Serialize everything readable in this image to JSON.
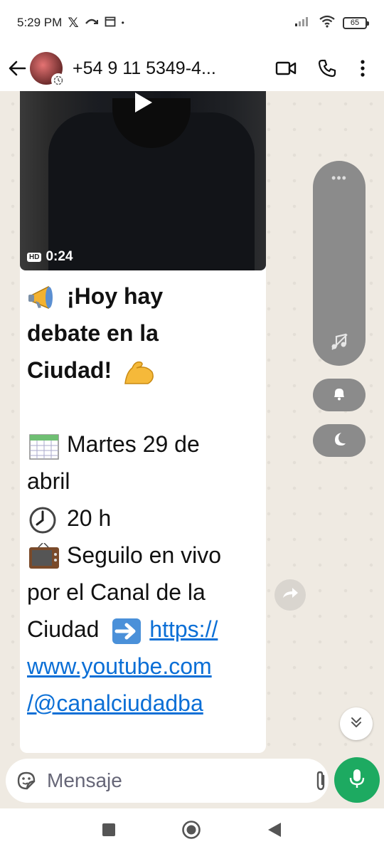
{
  "status_bar": {
    "time": "5:29 PM",
    "x_logo": "𝕏",
    "battery": "65"
  },
  "header": {
    "contact_name": "+54 9 11 5349-4..."
  },
  "video": {
    "quality": "HD",
    "duration": "0:24"
  },
  "message": {
    "line1": "¡Hoy hay",
    "line2": "debate en la",
    "line3": "Ciudad!",
    "line4": "Martes 29 de",
    "line5": "abril",
    "line6": "20 h",
    "line7": "Seguilo en vivo",
    "line8": "por el Canal de la",
    "line9_text": "Ciudad",
    "link_part1": "https://",
    "link_part2": "www.youtube.com",
    "link_part3": "/@canalciudadba"
  },
  "side_panel": {
    "dots": "•••"
  },
  "input": {
    "placeholder": "Mensaje"
  },
  "colors": {
    "accent_green": "#1daa61",
    "link_blue": "#0b6fd6",
    "chat_bg": "#efeae2"
  },
  "icons": [
    "back-arrow-icon",
    "video-call-icon",
    "phone-icon",
    "more-vert-icon",
    "play-icon",
    "megaphone-icon",
    "flexed-biceps-icon",
    "calendar-icon",
    "clock-icon",
    "television-icon",
    "right-arrow-icon",
    "music-off-icon",
    "bell-icon",
    "moon-icon",
    "forward-icon",
    "chevron-double-down-icon",
    "sticker-icon",
    "paperclip-icon",
    "camera-icon",
    "mic-icon",
    "square-nav-icon",
    "circle-nav-icon",
    "triangle-nav-icon"
  ]
}
